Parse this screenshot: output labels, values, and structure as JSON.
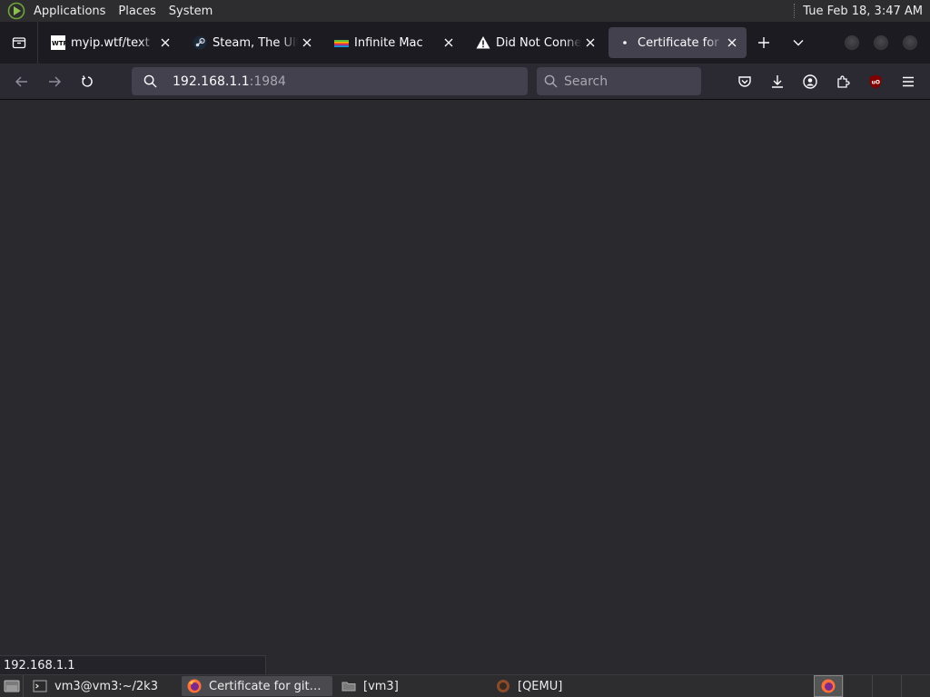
{
  "top_panel": {
    "menus": [
      "Applications",
      "Places",
      "System"
    ],
    "clock": "Tue Feb 18,  3:47 AM"
  },
  "tabs": [
    {
      "title": "myip.wtf/text",
      "favicon": "wtf-icon",
      "selected": false
    },
    {
      "title": "Steam, The Ultimate",
      "favicon": "steam-icon",
      "selected": false
    },
    {
      "title": "Infinite Mac",
      "favicon": "infinite-mac-icon",
      "selected": false
    },
    {
      "title": "Did Not Connect",
      "favicon": "warning-icon",
      "selected": false
    },
    {
      "title": "Certificate for github",
      "favicon": "dot-icon",
      "selected": true
    }
  ],
  "url_bar": {
    "host": "192.168.1.1",
    "port": ":1984"
  },
  "search_bar": {
    "placeholder": "Search"
  },
  "status_text": "192.168.1.1",
  "taskbar": {
    "items": [
      {
        "label": "vm3@vm3:~/2k3",
        "icon": "terminal-icon",
        "active": false
      },
      {
        "label": "Certificate for githu...",
        "icon": "firefox-icon",
        "active": true
      },
      {
        "label": "[vm3]",
        "icon": "folder-icon",
        "active": false
      },
      {
        "label": "[QEMU]",
        "icon": "qemu-icon",
        "active": false
      }
    ]
  },
  "colors": {
    "toolbar": "#2b2a33",
    "tabstrip": "#1c1b22",
    "selected_tab": "#42414d",
    "content": "#2a2a2e",
    "ublock_red": "#800000"
  }
}
